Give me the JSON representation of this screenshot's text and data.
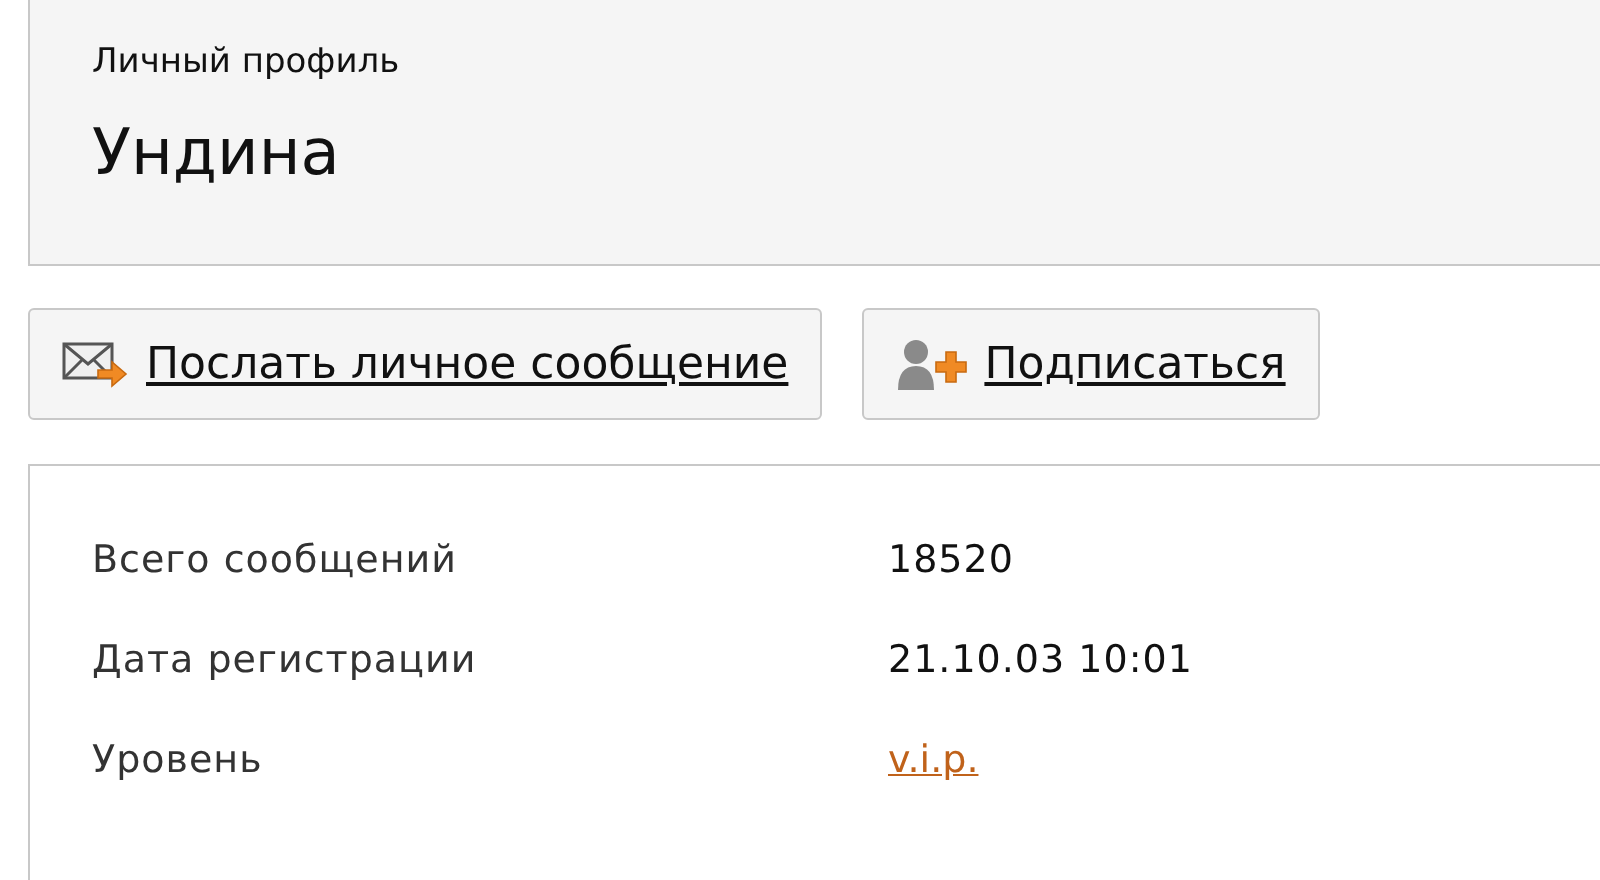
{
  "header": {
    "subtitle": "Личный профиль",
    "title": "Ундина"
  },
  "buttons": [
    {
      "kind": "message",
      "label": "Послать личное сообщение"
    },
    {
      "kind": "subscribe",
      "label": "Подписаться"
    }
  ],
  "stats": [
    {
      "label": "Всего сообщений",
      "value": "18520",
      "kind": "text"
    },
    {
      "label": "Дата регистрации",
      "value": "21.10.03 10:01",
      "kind": "text"
    },
    {
      "label": "Уровень",
      "value": "v.i.p.",
      "kind": "link"
    }
  ]
}
